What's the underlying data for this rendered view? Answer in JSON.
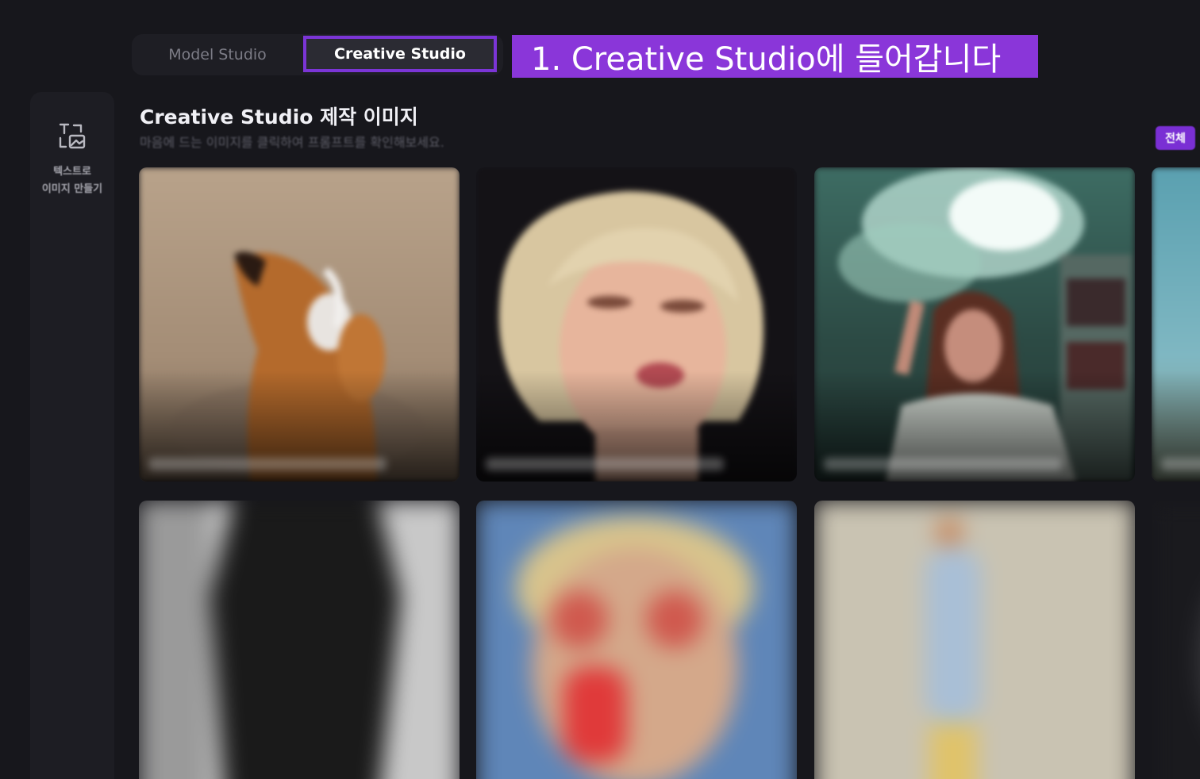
{
  "tabs": {
    "model_studio": "Model Studio",
    "creative_studio": "Creative Studio"
  },
  "annotation": "1. Creative Studio에 들어갑니다",
  "sidebar": {
    "tool_label_line1": "텍스트로",
    "tool_label_line2": "이미지 만들기",
    "tool_icon": "text-to-image-icon"
  },
  "section": {
    "title": "Creative Studio 제작 이미지",
    "subtitle": "마음에 드는 이미지를 클릭하여 프롬프트를 확인해보세요.",
    "all_button": "전체"
  },
  "colors": {
    "accent": "#7b35d6",
    "annotation_bg": "#8a36d9",
    "background": "#17171c"
  },
  "gallery": [
    {
      "subject": "dog-with-headphones"
    },
    {
      "subject": "blonde-woman-portrait"
    },
    {
      "subject": "woman-with-smoke"
    },
    {
      "subject": "partial-landscape"
    },
    {
      "subject": "dark-figure"
    },
    {
      "subject": "woman-red-sunglasses"
    },
    {
      "subject": "standing-figure"
    }
  ]
}
